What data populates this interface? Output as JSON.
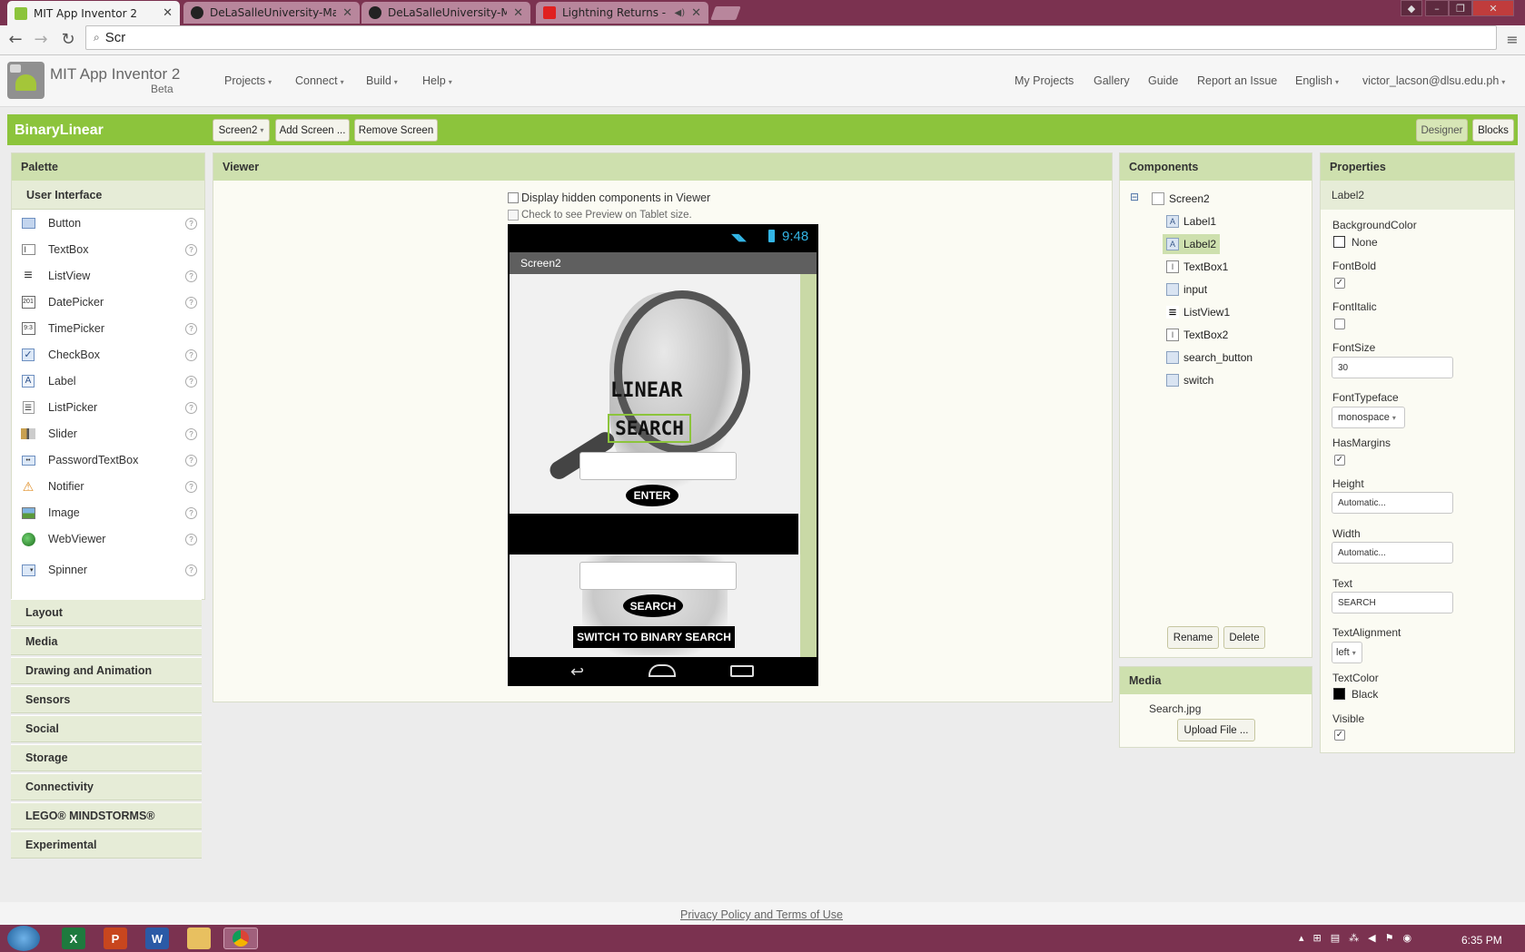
{
  "browser": {
    "tabs": [
      {
        "title": "MIT App Inventor 2",
        "active": true
      },
      {
        "title": "DeLaSalleUniversity-Manil",
        "active": false
      },
      {
        "title": "DeLaSalleUniversity-Manil",
        "active": false
      },
      {
        "title": "Lightning Returns - Full",
        "active": false
      }
    ],
    "address": "Scr"
  },
  "app": {
    "name": "MIT App Inventor 2",
    "beta": "Beta",
    "menus": [
      "Projects",
      "Connect",
      "Build",
      "Help"
    ],
    "right_links": [
      "My Projects",
      "Gallery",
      "Guide",
      "Report an Issue",
      "English",
      "victor_lacson@dlsu.edu.ph"
    ]
  },
  "projectbar": {
    "project": "BinaryLinear",
    "screen_select": "Screen2",
    "add_screen": "Add Screen ...",
    "remove_screen": "Remove Screen",
    "designer": "Designer",
    "blocks": "Blocks"
  },
  "palette": {
    "title": "Palette",
    "open_category": "User Interface",
    "items": [
      {
        "label": "Button",
        "icon": "button-icon"
      },
      {
        "label": "TextBox",
        "icon": "textbox-icon"
      },
      {
        "label": "ListView",
        "icon": "listview-icon"
      },
      {
        "label": "DatePicker",
        "icon": "datepicker-icon"
      },
      {
        "label": "TimePicker",
        "icon": "timepicker-icon"
      },
      {
        "label": "CheckBox",
        "icon": "checkbox-icon"
      },
      {
        "label": "Label",
        "icon": "label-icon"
      },
      {
        "label": "ListPicker",
        "icon": "listpicker-icon"
      },
      {
        "label": "Slider",
        "icon": "slider-icon"
      },
      {
        "label": "PasswordTextBox",
        "icon": "password-icon"
      },
      {
        "label": "Notifier",
        "icon": "notifier-icon"
      },
      {
        "label": "Image",
        "icon": "image-icon"
      },
      {
        "label": "WebViewer",
        "icon": "webviewer-icon"
      },
      {
        "label": "Spinner",
        "icon": "spinner-icon"
      }
    ],
    "categories": [
      "Layout",
      "Media",
      "Drawing and Animation",
      "Sensors",
      "Social",
      "Storage",
      "Connectivity",
      "LEGO® MINDSTORMS®",
      "Experimental"
    ],
    "help": "?"
  },
  "viewer": {
    "title": "Viewer",
    "hidden_components": "Display hidden components in Viewer",
    "tablet_preview": "Check to see Preview on Tablet size.",
    "phone": {
      "time": "9:48",
      "screen_title": "Screen2",
      "label_linear": "LINEAR",
      "label_search": "SEARCH",
      "enter_button": "ENTER",
      "search_button": "SEARCH",
      "switch_button": "SWITCH TO BINARY SEARCH"
    }
  },
  "components": {
    "title": "Components",
    "collapse": "⊟",
    "root": "Screen2",
    "children": [
      "Label1",
      "Label2",
      "TextBox1",
      "input",
      "ListView1",
      "TextBox2",
      "search_button",
      "switch"
    ],
    "selected": "Label2",
    "rename": "Rename",
    "delete": "Delete"
  },
  "media": {
    "title": "Media",
    "file": "Search.jpg",
    "upload": "Upload File ..."
  },
  "properties": {
    "title": "Properties",
    "component": "Label2",
    "BackgroundColor": {
      "label": "BackgroundColor",
      "value": "None",
      "color": "#ffffff"
    },
    "FontBold": {
      "label": "FontBold",
      "checked": true
    },
    "FontItalic": {
      "label": "FontItalic",
      "checked": false
    },
    "FontSize": {
      "label": "FontSize",
      "value": "30"
    },
    "FontTypeface": {
      "label": "FontTypeface",
      "value": "monospace"
    },
    "HasMargins": {
      "label": "HasMargins",
      "checked": true
    },
    "Height": {
      "label": "Height",
      "value": "Automatic..."
    },
    "Width": {
      "label": "Width",
      "value": "Automatic..."
    },
    "Text": {
      "label": "Text",
      "value": "SEARCH"
    },
    "TextAlignment": {
      "label": "TextAlignment",
      "value": "left"
    },
    "TextColor": {
      "label": "TextColor",
      "value": "Black",
      "color": "#000000"
    },
    "Visible": {
      "label": "Visible",
      "checked": true
    }
  },
  "footer": {
    "link": "Privacy Policy and Terms of Use"
  },
  "taskbar": {
    "time": "6:35 PM"
  },
  "colors": {
    "accent_green": "#8cc43c",
    "panel_head": "#cee0ae",
    "window_frame": "#7b3250"
  }
}
